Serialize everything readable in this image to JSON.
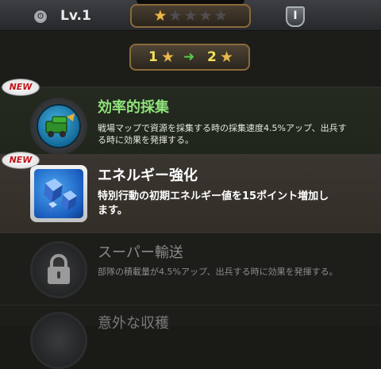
{
  "header": {
    "level_label": "Lv.1",
    "stars": {
      "filled": 1,
      "total": 5
    },
    "info_label": "I"
  },
  "upgrade": {
    "from": "1",
    "to": "2"
  },
  "skills": [
    {
      "badge": "NEW",
      "title": "効率的採集",
      "desc_line1": "戦場マップで資源を採集する時の採集速度4.5%アップ、出兵す",
      "desc_line2": "る時に効果を発揮する。",
      "title_color": "#8fe27a",
      "icon": "gather-cart-icon"
    },
    {
      "badge": "NEW",
      "title": "エネルギー強化",
      "desc_line1": "特別行動の初期エネルギー値を15ポイント増加し",
      "desc_line2": "ます。",
      "title_color": "#ffffff",
      "icon": "energy-cubes-icon"
    },
    {
      "title": "スーパー輸送",
      "desc_line1": "部隊の積載量が4.5%アップ、出兵する時に効果を発揮する。",
      "title_color": "#8a8a8a",
      "state": "locked",
      "icon": "lock-icon"
    },
    {
      "title": "意外な収穫",
      "state": "locked",
      "icon": "lock-icon"
    }
  ]
}
